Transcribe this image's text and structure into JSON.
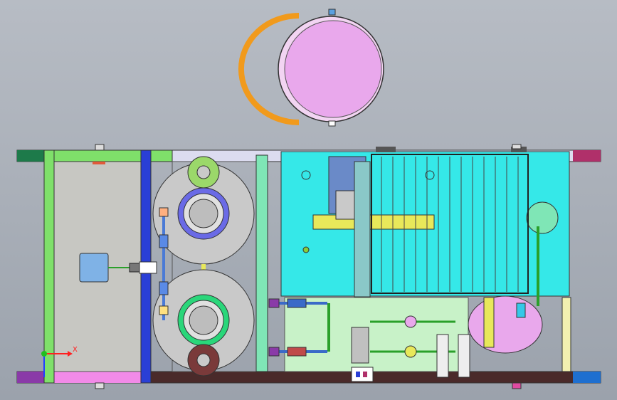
{
  "window": {
    "background_top": "#b7bcc4",
    "background_bottom": "#9ba2ac"
  },
  "triad": {
    "x_label": "X",
    "x_color": "#ff2020",
    "y_color": "#2040ff",
    "origin_color": "#20c020"
  },
  "colors": {
    "frame_rail": "#4a2a2a",
    "left_panel": "#c7c7c2",
    "green_bar": "#7fe06a",
    "blue_bar": "#2a3fd6",
    "cyan_tank": "#35e8e8",
    "pink_vessel": "#e9a8ec",
    "orange_band": "#f19a1c",
    "yellow_shaft": "#e8e85a",
    "magenta_end": "#b0306a",
    "dark_green_end": "#1d7a4a",
    "filter_disk": "#c9c9c9",
    "pale_green_plate": "#c8f2c8",
    "motor_blue": "#7fb2e6"
  },
  "icons": [
    "axis-triad-icon"
  ]
}
